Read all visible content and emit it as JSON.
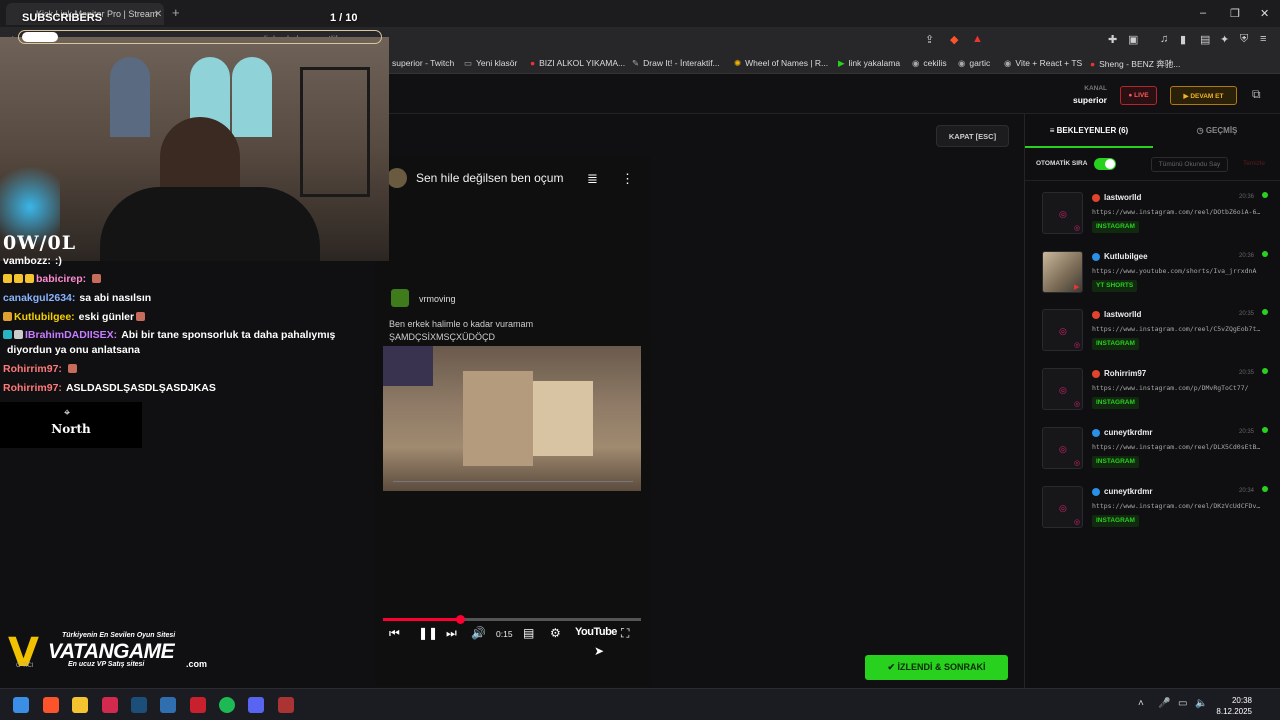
{
  "browser": {
    "tab_title": "Kick Link Monitor Pro | Stream",
    "url": "linkyakalama.netlify.app",
    "bookmarks": [
      {
        "label": "superior - Twitch",
        "icon": "twitch-icon"
      },
      {
        "label": "Yeni klasör",
        "icon": "folder-icon"
      },
      {
        "label": "BIZI ALKOL YIKAMA...",
        "icon": "youtube-icon"
      },
      {
        "label": "Draw It! - İnteraktif...",
        "icon": "draw-icon"
      },
      {
        "label": "Wheel of Names | R...",
        "icon": "wheel-icon"
      },
      {
        "label": "link yakalama",
        "icon": "kick-icon"
      },
      {
        "label": "cekilis",
        "icon": "globe-icon"
      },
      {
        "label": "gartic",
        "icon": "globe-icon"
      },
      {
        "label": "Vite + React + TS",
        "icon": "globe-icon"
      },
      {
        "label": "Sheng - BENZ 奔驰...",
        "icon": "youtube-icon"
      }
    ]
  },
  "overlay": {
    "subscribers_label": "SUBSCRIBERS",
    "sub_count": "1 / 10",
    "owol": "0W/0L",
    "north": "North"
  },
  "header": {
    "kanal_label": "KANAL",
    "kanal_name": "superior",
    "live_label": "LIVE",
    "devam_label": "DEVAM ET"
  },
  "player": {
    "close_label": "KAPAT [ESC]",
    "title": "Sen hile değilsen ben oçum",
    "comment_user": "vrmoving",
    "caption": "Ben erkek halimle o kadar vuramam\nŞAMDÇSİXMSÇXÜDÖÇD",
    "time": "0:15",
    "progress": 0.3,
    "brand": "YouTube"
  },
  "action": {
    "next_label": "İZLENDİ & SONRAKİ"
  },
  "panel": {
    "tab_waiting": "BEKLEYENLER (6)",
    "tab_history": "GEÇMİŞ",
    "auto_label": "OTOMATİK SIRA",
    "mark_all_label": "Tümünü Okundu Say",
    "clear_label": "Temizle",
    "items": [
      {
        "user": "lastworlld",
        "src": "kick",
        "time": "20:36",
        "link": "https://www.instagram.com/reel/DOtbZ6oiA-6…",
        "platform": "INSTAGRAM",
        "thumb": "ig"
      },
      {
        "user": "Kutlubilgee",
        "src": "twitch",
        "time": "20:36",
        "link": "https://www.youtube.com/shorts/Iva_jrrxdnA",
        "platform": "YT SHORTS",
        "thumb": "img"
      },
      {
        "user": "lastworlld",
        "src": "kick",
        "time": "20:35",
        "link": "https://www.instagram.com/reel/C5vZQgEob7t…",
        "platform": "INSTAGRAM",
        "thumb": "ig"
      },
      {
        "user": "Rohirrim97",
        "src": "kick",
        "time": "20:35",
        "link": "https://www.instagram.com/p/DMvRgToCt77/",
        "platform": "INSTAGRAM",
        "thumb": "ig"
      },
      {
        "user": "cuneytkrdmr",
        "src": "twitch",
        "time": "20:35",
        "link": "https://www.instagram.com/reel/DLX5Cd0sEtB…",
        "platform": "INSTAGRAM",
        "thumb": "ig"
      },
      {
        "user": "cuneytkrdmr",
        "src": "twitch",
        "time": "20:34",
        "link": "https://www.instagram.com/reel/DKzVcUdCFDv…",
        "platform": "INSTAGRAM",
        "thumb": "ig"
      }
    ]
  },
  "chat": [
    {
      "user": "vambozz:",
      "text": ":)",
      "color": "#ffffff"
    },
    {
      "user": "babicirep:",
      "text": "",
      "color": "#ff8ad0"
    },
    {
      "user": "canakgul2634:",
      "text": "sa abi nasılsın",
      "color": "#8ab4ff"
    },
    {
      "user": "Kutlubilgee:",
      "text": "eski günler",
      "color": "#f5d000"
    },
    {
      "user": "IBrahimDADIISEX:",
      "text": "Abi bir tane sponsorluk ta daha pahalıymış",
      "color": "#c77dff"
    },
    {
      "user": "",
      "text": "diyordun ya onu anlatsana",
      "color": "#ffffff"
    },
    {
      "user": "Rohirrim97:",
      "text": "",
      "color": "#ff7a7a"
    },
    {
      "user": "Rohirrim97:",
      "text": "ASLDASDLŞASDLŞASDJKAS",
      "color": "#ff7a7a"
    }
  ],
  "sponsor": {
    "tagline": "Türkiyenin En Sevilen Oyun Sitesi",
    "name": "VATANGAME",
    "sub": "En ucuz VP Satış sitesi",
    "domain": ".com",
    "small": "O TICI"
  },
  "taskbar": {
    "time": "20:38",
    "date": "8.12.2025"
  },
  "colors": {
    "accent": "#29d11f",
    "live": "#ff5a5f",
    "devam": "#f0b429"
  }
}
